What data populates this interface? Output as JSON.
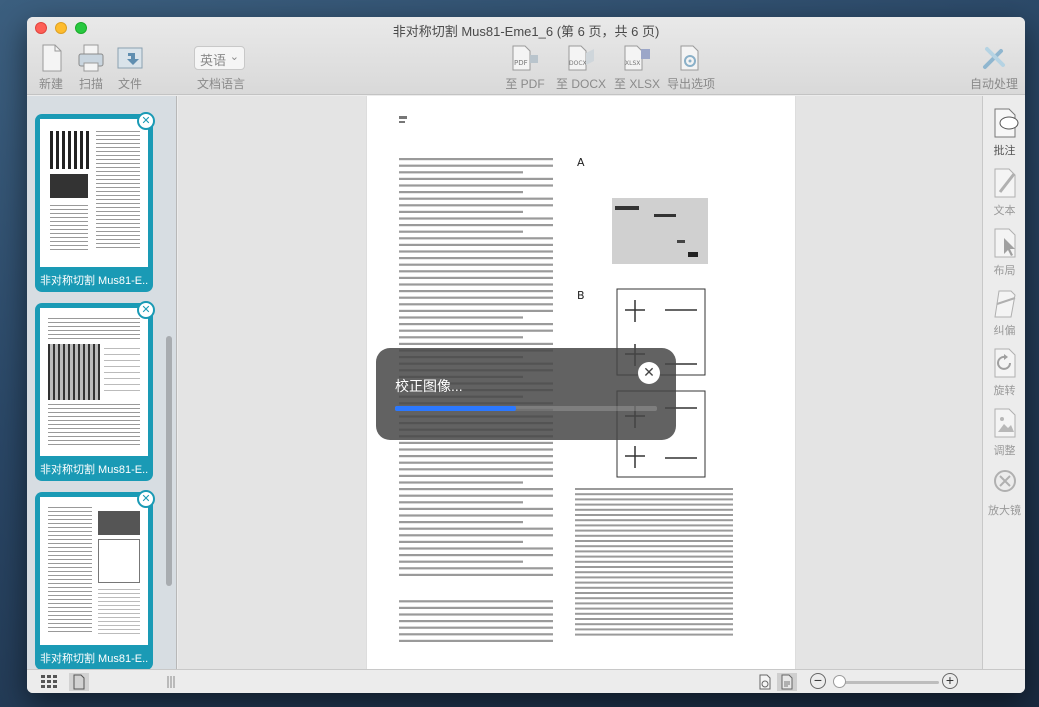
{
  "window": {
    "title": "非对称切割 Mus81-Eme1_6 (第 6 页，共 6 页)"
  },
  "toolbar": {
    "new_label": "新建",
    "scan_label": "扫描",
    "file_label": "文件",
    "lang_value": "英语",
    "lang_label": "文档语言",
    "to_pdf_label": "至 PDF",
    "to_docx_label": "至 DOCX",
    "to_xlsx_label": "至 XLSX",
    "export_options_label": "导出选项",
    "auto_process_label": "自动处理"
  },
  "sidebar": {
    "pages": [
      {
        "caption": "非对称切割 Mus81-E..."
      },
      {
        "caption": "非对称切割 Mus81-E..."
      },
      {
        "caption": "非对称切割 Mus81-E..."
      }
    ]
  },
  "rightbar": {
    "items": [
      {
        "label": "批注"
      },
      {
        "label": "文本"
      },
      {
        "label": "布局"
      },
      {
        "label": "纠偏"
      },
      {
        "label": "旋转"
      },
      {
        "label": "调整"
      },
      {
        "label": "放大镜"
      }
    ]
  },
  "progress": {
    "text": "校正图像...",
    "fraction": 0.46
  },
  "colors": {
    "accent": "#1a9ab5",
    "progress": "#2b78ff"
  }
}
